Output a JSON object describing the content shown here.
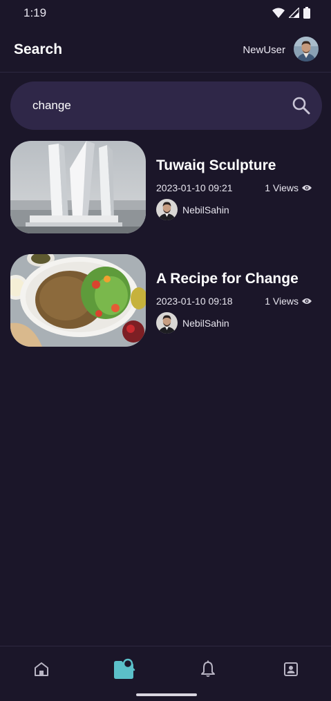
{
  "status_bar": {
    "time": "1:19",
    "icons": [
      "wifi-icon",
      "signal-icon",
      "battery-icon"
    ]
  },
  "app_bar": {
    "title": "Search",
    "username": "NewUser"
  },
  "search": {
    "value": "change",
    "placeholder": ""
  },
  "results": [
    {
      "title": "Tuwaiq Sculpture",
      "date": "2023-01-10 09:21",
      "views": "1 Views",
      "author": "NebilSahin"
    },
    {
      "title": "A Recipe for Change",
      "date": "2023-01-10 09:18",
      "views": "1 Views",
      "author": "NebilSahin"
    }
  ],
  "bottom_nav": {
    "items": [
      "home-icon",
      "search-icon",
      "bell-icon",
      "profile-icon"
    ],
    "active": "search-icon",
    "active_color": "#5bc0c9",
    "inactive_color": "#b9b5c4"
  },
  "colors": {
    "background": "#1b1629",
    "search_bg": "#2f2748",
    "divider": "#2e2840"
  }
}
